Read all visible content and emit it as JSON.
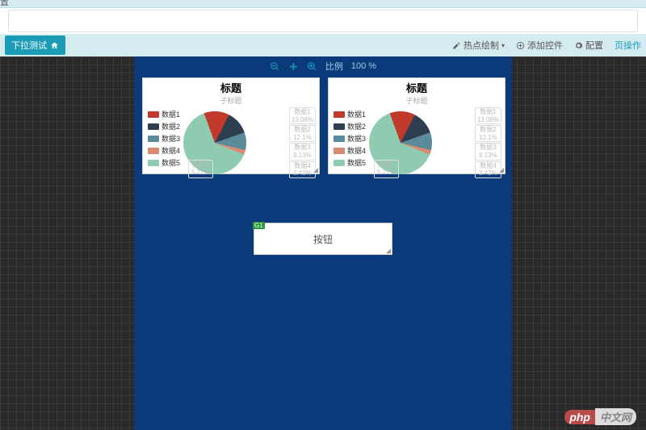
{
  "topbar_char": "置",
  "test_button": "下拉测试",
  "toolbar": {
    "hotspot": "热点绘制",
    "add_widget": "添加控件",
    "config": "配置",
    "page_ops": "页操作"
  },
  "zoom": {
    "label": "比例",
    "value": "100 %"
  },
  "chart_data": [
    {
      "type": "pie",
      "title": "标题",
      "subtitle": "子标题",
      "series": [
        {
          "name": "数据1",
          "value": 13.08,
          "color": "#c0392b",
          "label": "数据1",
          "pct": "13.08%"
        },
        {
          "name": "数据2",
          "value": 12.1,
          "color": "#2c3e50",
          "label": "数据2",
          "pct": "12.1%"
        },
        {
          "name": "数据3",
          "value": 9.13,
          "color": "#5b8a9a",
          "label": "数据3",
          "pct": "9.13%"
        },
        {
          "name": "数据4",
          "value": 2.42,
          "color": "#d98b6f",
          "label": "数据4",
          "pct": "2.42%"
        },
        {
          "name": "数据5",
          "value": 63.27,
          "color": "#8fcbb0",
          "label": "数据5",
          "pct": "63.27%"
        }
      ],
      "big_label": {
        "name": "数据5",
        "pct": "5.27%"
      }
    },
    {
      "type": "pie",
      "title": "标题",
      "subtitle": "子标题",
      "series": [
        {
          "name": "数据1",
          "value": 13.08,
          "color": "#c0392b",
          "label": "数据1",
          "pct": "13.08%"
        },
        {
          "name": "数据2",
          "value": 12.1,
          "color": "#2c3e50",
          "label": "数据2",
          "pct": "12.1%"
        },
        {
          "name": "数据3",
          "value": 9.13,
          "color": "#5b8a9a",
          "label": "数据3",
          "pct": "9.13%"
        },
        {
          "name": "数据4",
          "value": 2.42,
          "color": "#d98b6f",
          "label": "数据4",
          "pct": "2.42%"
        },
        {
          "name": "数据5",
          "value": 63.27,
          "color": "#8fcbb0",
          "label": "数据5",
          "pct": "63.27%"
        }
      ],
      "big_label": {
        "name": "数据5",
        "pct": "5.27%"
      }
    }
  ],
  "button_widget": {
    "badge": "G1",
    "label": "按钮"
  },
  "watermark": {
    "left": "php",
    "right": "中文网"
  }
}
